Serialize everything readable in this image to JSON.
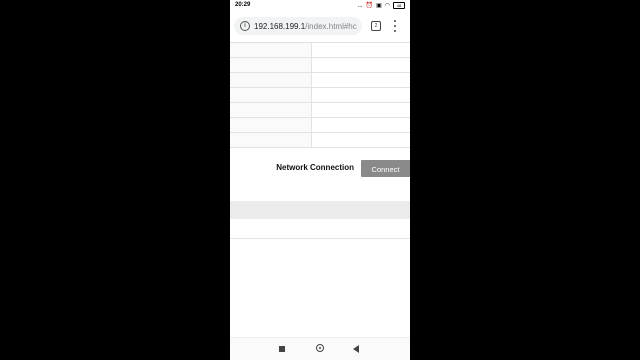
{
  "status_bar": {
    "time": "20:29",
    "icons": [
      "dots-icon",
      "alarm-icon",
      "sim-icon",
      "wifi-icon",
      "battery-icon"
    ],
    "more": "...",
    "battery": "48"
  },
  "browser": {
    "url_host": "192.168.199.1",
    "url_path": "/index.html#hc",
    "tab_count": "2"
  },
  "table": {
    "rows": [
      [
        "",
        ""
      ],
      [
        "",
        ""
      ],
      [
        "",
        ""
      ],
      [
        "",
        ""
      ],
      [
        "",
        ""
      ],
      [
        "",
        ""
      ],
      [
        "",
        ""
      ]
    ]
  },
  "network": {
    "label": "Network Connection",
    "button_label": "Connect"
  },
  "colors": {
    "button_bg": "#8a8a8a",
    "band_bg": "#ececec"
  }
}
